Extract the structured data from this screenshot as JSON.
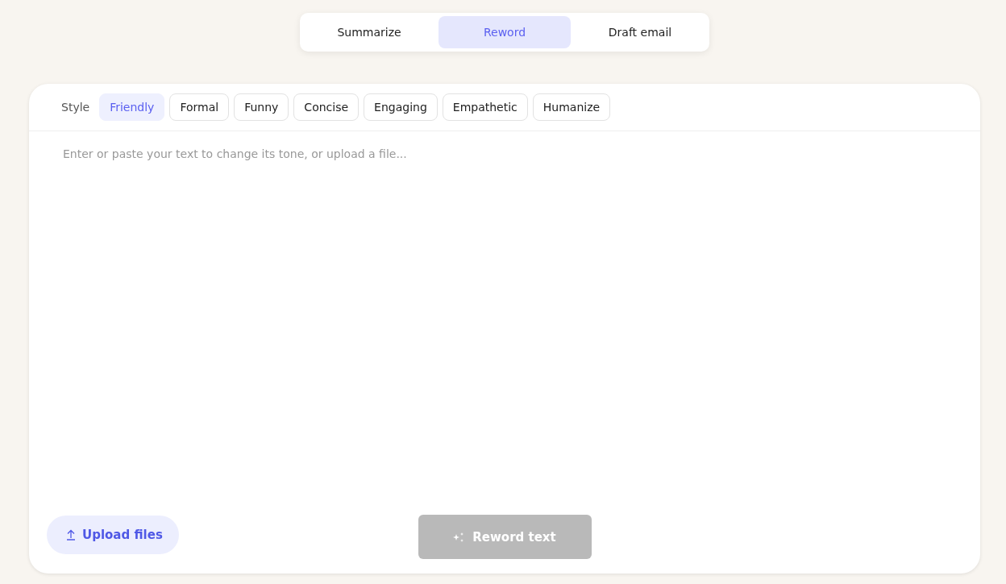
{
  "mode_tabs": [
    {
      "label": "Summarize",
      "selected": false
    },
    {
      "label": "Reword",
      "selected": true
    },
    {
      "label": "Draft email",
      "selected": false
    }
  ],
  "style_label": "Style",
  "styles": [
    {
      "label": "Friendly",
      "selected": true
    },
    {
      "label": "Formal",
      "selected": false
    },
    {
      "label": "Funny",
      "selected": false
    },
    {
      "label": "Concise",
      "selected": false
    },
    {
      "label": "Engaging",
      "selected": false
    },
    {
      "label": "Empathetic",
      "selected": false
    },
    {
      "label": "Humanize",
      "selected": false
    }
  ],
  "input": {
    "placeholder": "Enter or paste your text to change its tone, or upload a file..."
  },
  "upload_button": {
    "label": "Upload files"
  },
  "submit_button": {
    "label": "Reword text",
    "disabled": true
  }
}
